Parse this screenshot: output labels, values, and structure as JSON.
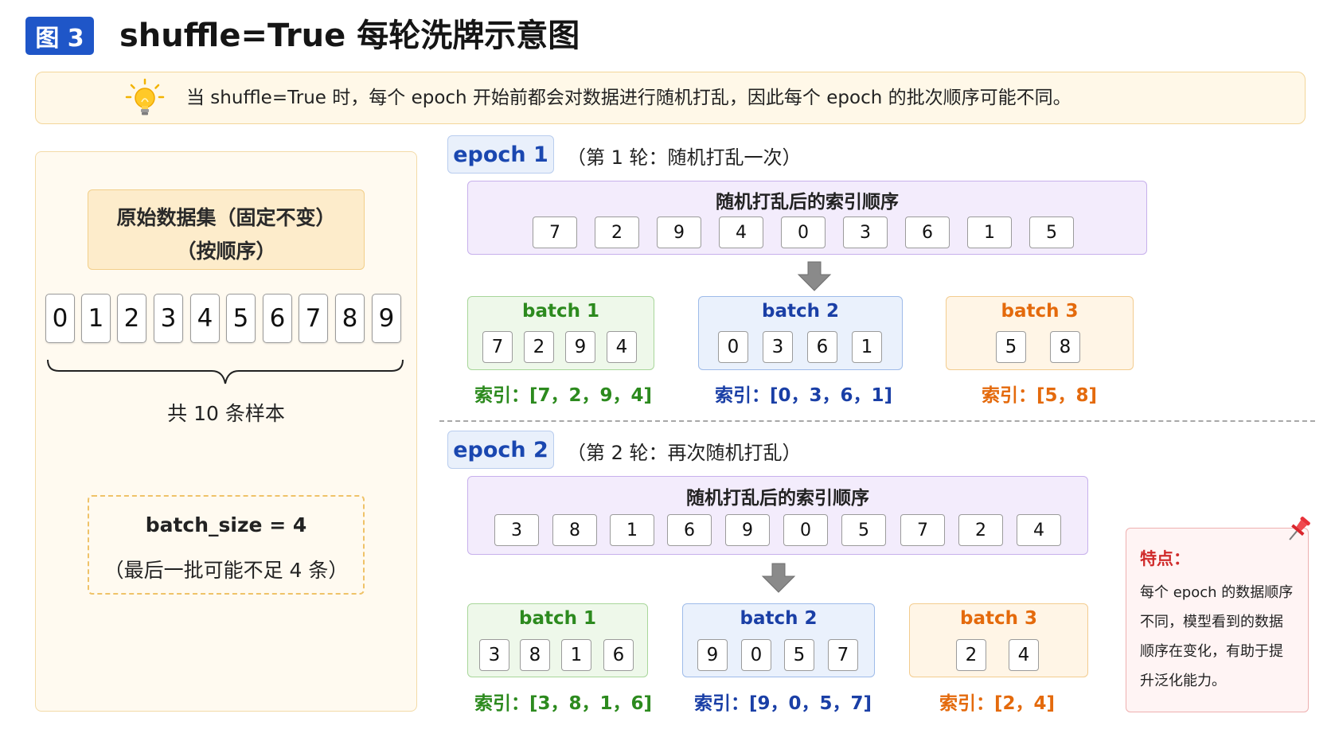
{
  "header": {
    "badge": "图 3",
    "title": "shuffle=True 每轮洗牌示意图"
  },
  "note": {
    "icon": "lightbulb-icon",
    "text": "当 shuffle=True 时，每个 epoch 开始前都会对数据进行随机打乱，因此每个 epoch 的批次顺序可能不同。"
  },
  "left": {
    "dataset_title_line1": "原始数据集（固定不变）",
    "dataset_title_line2": "（按顺序）",
    "cells": [
      "0",
      "1",
      "2",
      "3",
      "4",
      "5",
      "6",
      "7",
      "8",
      "9"
    ],
    "total": "共 10 条样本",
    "batch_size": "batch_size = 4",
    "batch_size_note": "（最后一批可能不足 4 条）"
  },
  "epochs": [
    {
      "label": "epoch 1",
      "desc": "（第 1 轮：随机打乱一次）",
      "shuffle_title": "随机打乱后的索引顺序",
      "order": [
        "7",
        "2",
        "9",
        "4",
        "0",
        "3",
        "6",
        "1",
        "5"
      ],
      "batches": [
        {
          "title": "batch 1",
          "cells": [
            "7",
            "2",
            "9",
            "4"
          ],
          "index": "索引：[7，2，9，4]"
        },
        {
          "title": "batch 2",
          "cells": [
            "0",
            "3",
            "6",
            "1"
          ],
          "index": "索引：[0，3，6，1]"
        },
        {
          "title": "batch 3",
          "cells": [
            "5",
            "8"
          ],
          "index": "索引：[5，8]"
        }
      ]
    },
    {
      "label": "epoch 2",
      "desc": "（第 2 轮：再次随机打乱）",
      "shuffle_title": "随机打乱后的索引顺序",
      "order": [
        "3",
        "8",
        "1",
        "6",
        "9",
        "0",
        "5",
        "7",
        "2",
        "4"
      ],
      "batches": [
        {
          "title": "batch 1",
          "cells": [
            "3",
            "8",
            "1",
            "6"
          ],
          "index": "索引：[3，8，1，6]"
        },
        {
          "title": "batch 2",
          "cells": [
            "9",
            "0",
            "5",
            "7"
          ],
          "index": "索引：[9，0，5，7]"
        },
        {
          "title": "batch 3",
          "cells": [
            "2",
            "4"
          ],
          "index": "索引：[2，4]"
        }
      ]
    }
  ],
  "feature": {
    "icon": "pushpin-icon",
    "title": "特点：",
    "lines": [
      "每个 epoch 的数据顺序",
      "不同，模型看到的数据",
      "顺序在变化，有助于提",
      "升泛化能力。"
    ]
  },
  "colors": {
    "badge": "#1f56c8",
    "epoch_text": "#1a47b0",
    "batch1": "#2c8a1e",
    "batch2": "#1a3fa6",
    "batch3": "#e46a0c",
    "feature_title": "#d02b2b"
  }
}
